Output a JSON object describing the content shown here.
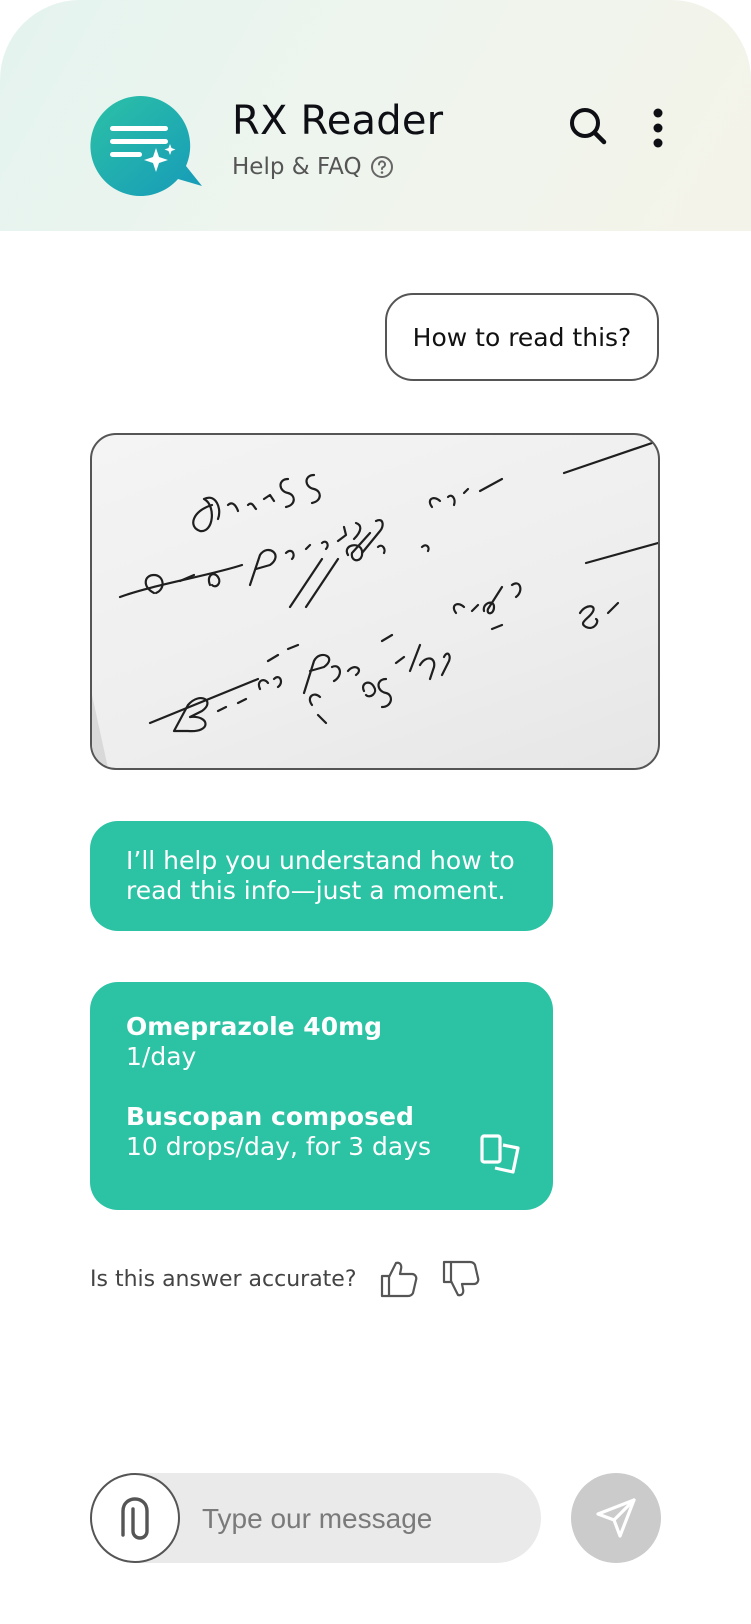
{
  "header": {
    "app_title": "RX Reader",
    "subtitle": "Help & FAQ",
    "icons": {
      "logo": "chat-sparkle-logo",
      "help": "question-circle-icon",
      "search": "search-icon",
      "more": "more-vertical-icon"
    }
  },
  "chat": {
    "user_message": "How to read this?",
    "attached_image": "handwritten-prescription-photo",
    "bot_intro": "I’ll help you understand how to read this info—just a moment.",
    "medications": [
      {
        "name": "Omeprazole 40mg",
        "dosage": "1/day"
      },
      {
        "name": "Buscopan composed",
        "dosage": "10 drops/day, for 3 days"
      }
    ],
    "copy_icon": "copy-icon"
  },
  "feedback": {
    "question": "Is this answer accurate?",
    "like_icon": "thumbs-up-icon",
    "dislike_icon": "thumbs-down-icon"
  },
  "composer": {
    "placeholder": "Type our message",
    "attach_icon": "paperclip-icon",
    "send_icon": "send-icon"
  },
  "colors": {
    "accent": "#2bc3a4",
    "logo_gradient_start": "#27b9a2",
    "logo_gradient_end": "#1a9fb8",
    "send_disabled": "#cbcbcb",
    "input_background": "#eaeaea"
  }
}
